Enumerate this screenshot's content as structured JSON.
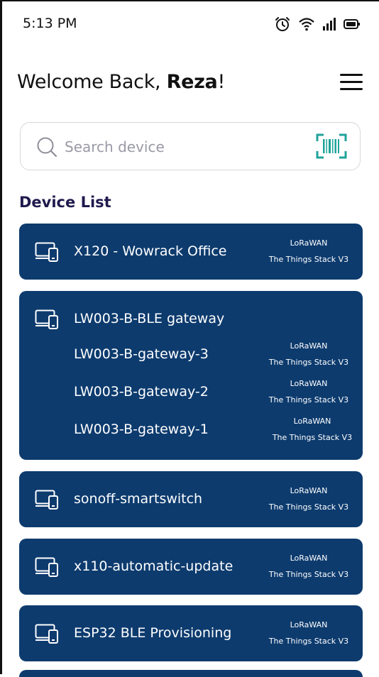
{
  "status_bar": {
    "time": "5:13 PM",
    "icons": [
      "alarm-icon",
      "wifi-icon",
      "signal-icon",
      "battery-icon"
    ]
  },
  "header": {
    "greeting": "Welcome Back, ",
    "user_name": "Reza",
    "exclaim": "!",
    "menu_icon": "hamburger-menu-icon"
  },
  "search": {
    "placeholder": "Search device",
    "value": "",
    "scan_icon": "barcode-scan-icon"
  },
  "device_list": {
    "title": "Device List",
    "colors": {
      "card": "#0d3b6e",
      "text": "#ffffff",
      "title": "#1f1a4d",
      "accent": "#1fa39a"
    },
    "cards": [
      {
        "items": [
          {
            "name": "X120 - Wowrack Office",
            "protocol": "LoRaWAN",
            "network": "The Things Stack V3"
          }
        ]
      },
      {
        "items": [
          {
            "name": "LW003-B-BLE gateway",
            "protocol": "",
            "network": ""
          },
          {
            "name": "LW003-B-gateway-3",
            "protocol": "LoRaWAN",
            "network": "The Things Stack V3"
          },
          {
            "name": "LW003-B-gateway-2",
            "protocol": "LoRaWAN",
            "network": "The Things Stack V3"
          },
          {
            "name": "LW003-B-gateway-1",
            "protocol": "LoRaWAN",
            "network": "The Things Stack V3"
          }
        ]
      },
      {
        "items": [
          {
            "name": "sonoff-smartswitch",
            "protocol": "LoRaWAN",
            "network": "The Things Stack V3"
          }
        ]
      },
      {
        "items": [
          {
            "name": "x110-automatic-update",
            "protocol": "LoRaWAN",
            "network": "The Things Stack V3"
          }
        ]
      },
      {
        "items": [
          {
            "name": "ESP32 BLE Provisioning",
            "protocol": "LoRaWAN",
            "network": "The Things Stack V3"
          }
        ]
      }
    ]
  }
}
